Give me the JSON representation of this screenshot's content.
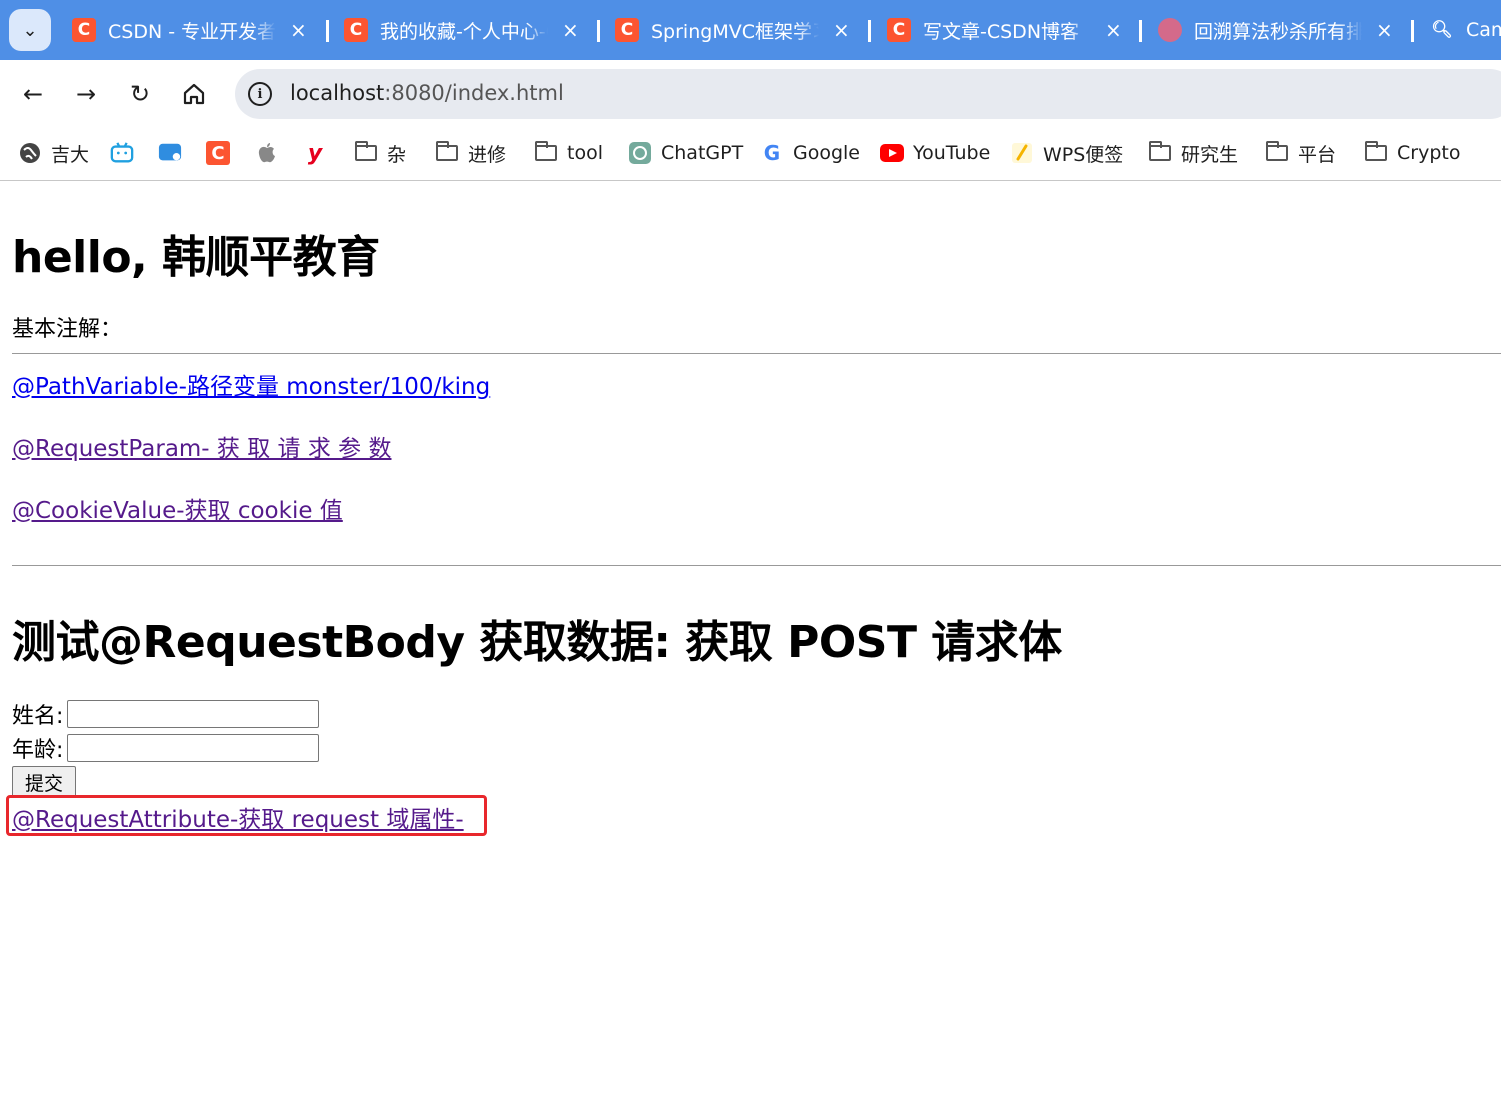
{
  "browser": {
    "tabs": [
      {
        "title": "CSDN - 专业开发者社区",
        "favicon": "C"
      },
      {
        "title": "我的收藏-个人中心-CSDN",
        "favicon": "C"
      },
      {
        "title": "SpringMVC框架学习",
        "favicon": "C"
      },
      {
        "title": "写文章-CSDN博客",
        "favicon": "C"
      },
      {
        "title": "回溯算法秒杀所有排列",
        "favicon": "algo-icon"
      },
      {
        "title": "Cambly",
        "favicon": "search-icon"
      }
    ],
    "tab_close": "×",
    "address": {
      "host": "localhost",
      "path": ":8080/index.html"
    },
    "bookmarks": [
      {
        "label": "吉大",
        "icon": "globe-icon"
      },
      {
        "label": "",
        "icon": "bilibili-icon"
      },
      {
        "label": "",
        "icon": "chat-icon"
      },
      {
        "label": "",
        "icon": "csdn-icon"
      },
      {
        "label": "",
        "icon": "apple-icon"
      },
      {
        "label": "",
        "icon": "youdao-icon"
      },
      {
        "label": "杂",
        "icon": "folder-icon"
      },
      {
        "label": "进修",
        "icon": "folder-icon"
      },
      {
        "label": "tool",
        "icon": "folder-icon"
      },
      {
        "label": "ChatGPT",
        "icon": "chatgpt-icon"
      },
      {
        "label": "Google",
        "icon": "google-icon"
      },
      {
        "label": "YouTube",
        "icon": "youtube-icon"
      },
      {
        "label": "WPS便签",
        "icon": "wps-icon"
      },
      {
        "label": "研究生",
        "icon": "folder-icon"
      },
      {
        "label": "平台",
        "icon": "folder-icon"
      },
      {
        "label": "Crypto",
        "icon": "folder-icon"
      }
    ]
  },
  "page": {
    "heading": "hello, 韩顺平教育",
    "basic_label": "基本注解：",
    "links": [
      "@PathVariable-路径变量 monster/100/king",
      "@RequestParam- 获 取 请 求 参 数",
      "@CookieValue-获取 cookie 值"
    ],
    "section_heading": "测试@RequestBody 获取数据: 获取 POST 请求体",
    "form": {
      "name_label": "姓名:",
      "age_label": "年龄:",
      "submit_label": "提交"
    },
    "highlighted_link": "@RequestAttribute-获取 request 域属性-"
  },
  "colors": {
    "tab_strip": "#4f8fe6",
    "link_visited": "#551a8b",
    "link_unvisited": "#0000ee",
    "highlight": "#e8272c"
  }
}
